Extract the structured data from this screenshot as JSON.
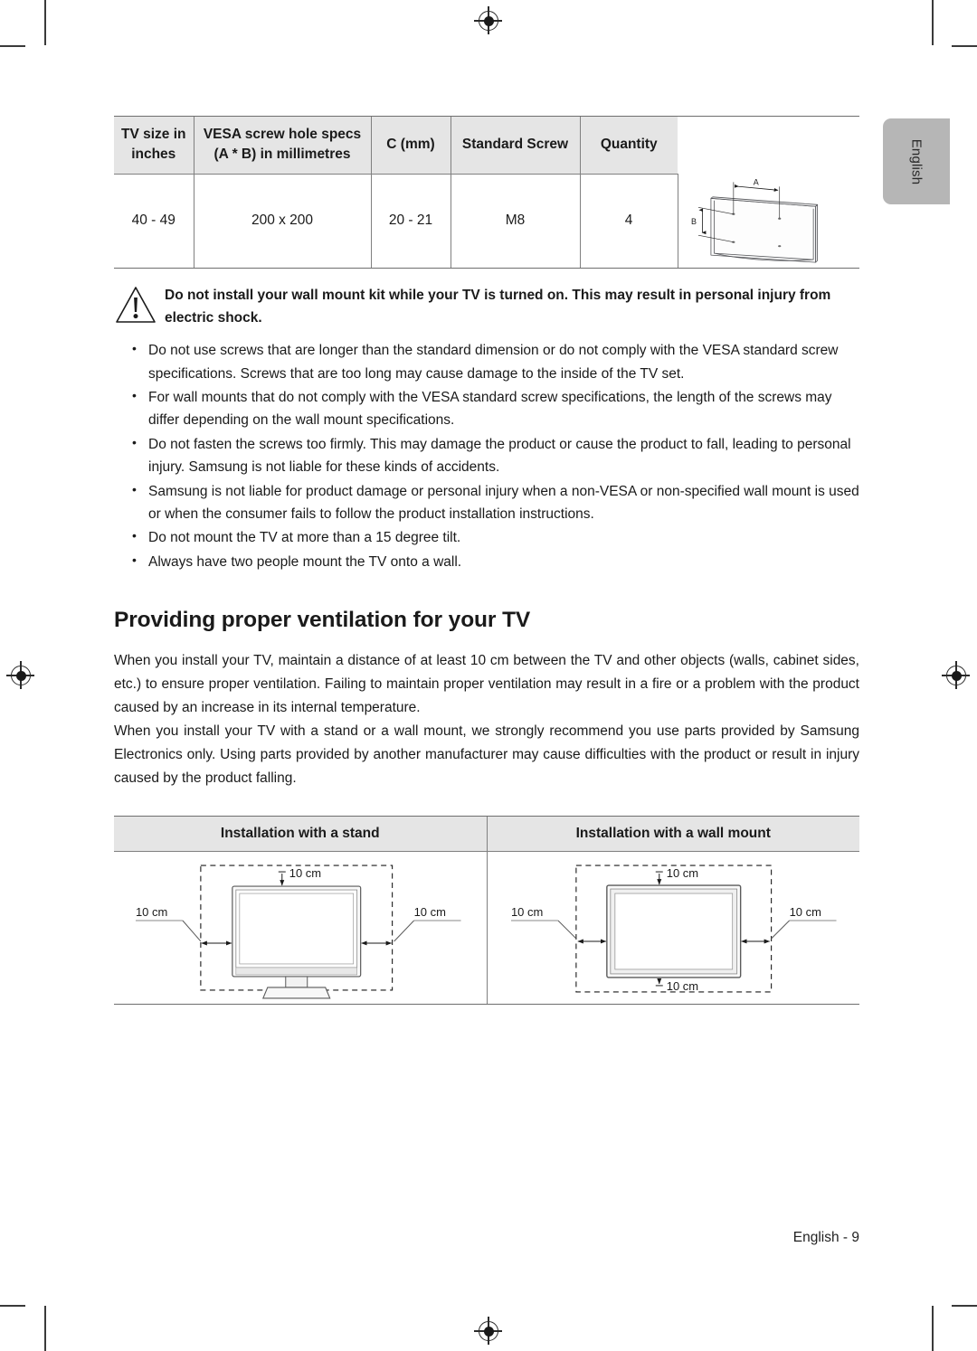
{
  "language_tab": {
    "label": "English"
  },
  "spec_table": {
    "headers": [
      "TV size in\ninches",
      "VESA screw hole specs\n(A * B) in millimetres",
      "C (mm)",
      "Standard Screw",
      "Quantity",
      ""
    ],
    "header_lines": {
      "col1_line1": "TV size in",
      "col1_line2": "inches",
      "col2_line1": "VESA screw hole specs",
      "col2_line2": "(A * B) in millimetres",
      "col3": "C (mm)",
      "col4": "Standard Screw",
      "col5": "Quantity"
    },
    "rows": [
      {
        "tv_size": "40 - 49",
        "vesa": "200 x 200",
        "c_mm": "20 - 21",
        "screw": "M8",
        "quantity": "4"
      }
    ],
    "figure_labels": {
      "a": "A",
      "b": "B"
    }
  },
  "warning": {
    "text": "Do not install your wall mount kit while your TV is turned on. This may result in personal injury from electric shock."
  },
  "bullets": [
    "Do not use screws that are longer than the standard dimension or do not comply with the VESA standard screw specifications. Screws that are too long may cause damage to the inside of the TV set.",
    "For wall mounts that do not comply with the VESA standard screw specifications, the length of the screws may differ depending on the wall mount specifications.",
    "Do not fasten the screws too firmly. This may damage the product or cause the product to fall, leading to personal injury. Samsung is not liable for these kinds of accidents.",
    "Samsung is not liable for product damage or personal injury when a non-VESA or non-specified wall mount is used or when the consumer fails to follow the product installation instructions.",
    "Do not mount the TV at more than a 15 degree tilt.",
    "Always have two people mount the TV onto a wall."
  ],
  "section": {
    "heading": "Providing proper ventilation for your TV",
    "paragraph1": "When you install your TV, maintain a distance of at least 10 cm between the TV and other objects (walls, cabinet sides, etc.) to ensure proper ventilation. Failing to maintain proper ventilation may result in a fire or a problem with the product caused by an increase in its internal temperature.",
    "paragraph2": "When you install your TV with a stand or a wall mount, we strongly recommend you use parts provided by Samsung Electronics only. Using parts provided by another manufacturer may cause difficulties with the product or result in injury caused by the product falling."
  },
  "install_table": {
    "headers": [
      "Installation with a stand",
      "Installation with a wall mount"
    ],
    "stand_diagram": {
      "top_label": "10 cm",
      "left_label": "10 cm",
      "right_label": "10 cm"
    },
    "wall_diagram": {
      "top_label": "10 cm",
      "left_label": "10 cm",
      "right_label": "10 cm",
      "bottom_label": "10 cm"
    }
  },
  "footer": {
    "page_label": "English - 9"
  },
  "colors": {
    "header_gray": "#e5e5e5",
    "tab_gray": "#b6b6b6",
    "rule": "#6e6e6e",
    "text": "#1a1a1a"
  }
}
